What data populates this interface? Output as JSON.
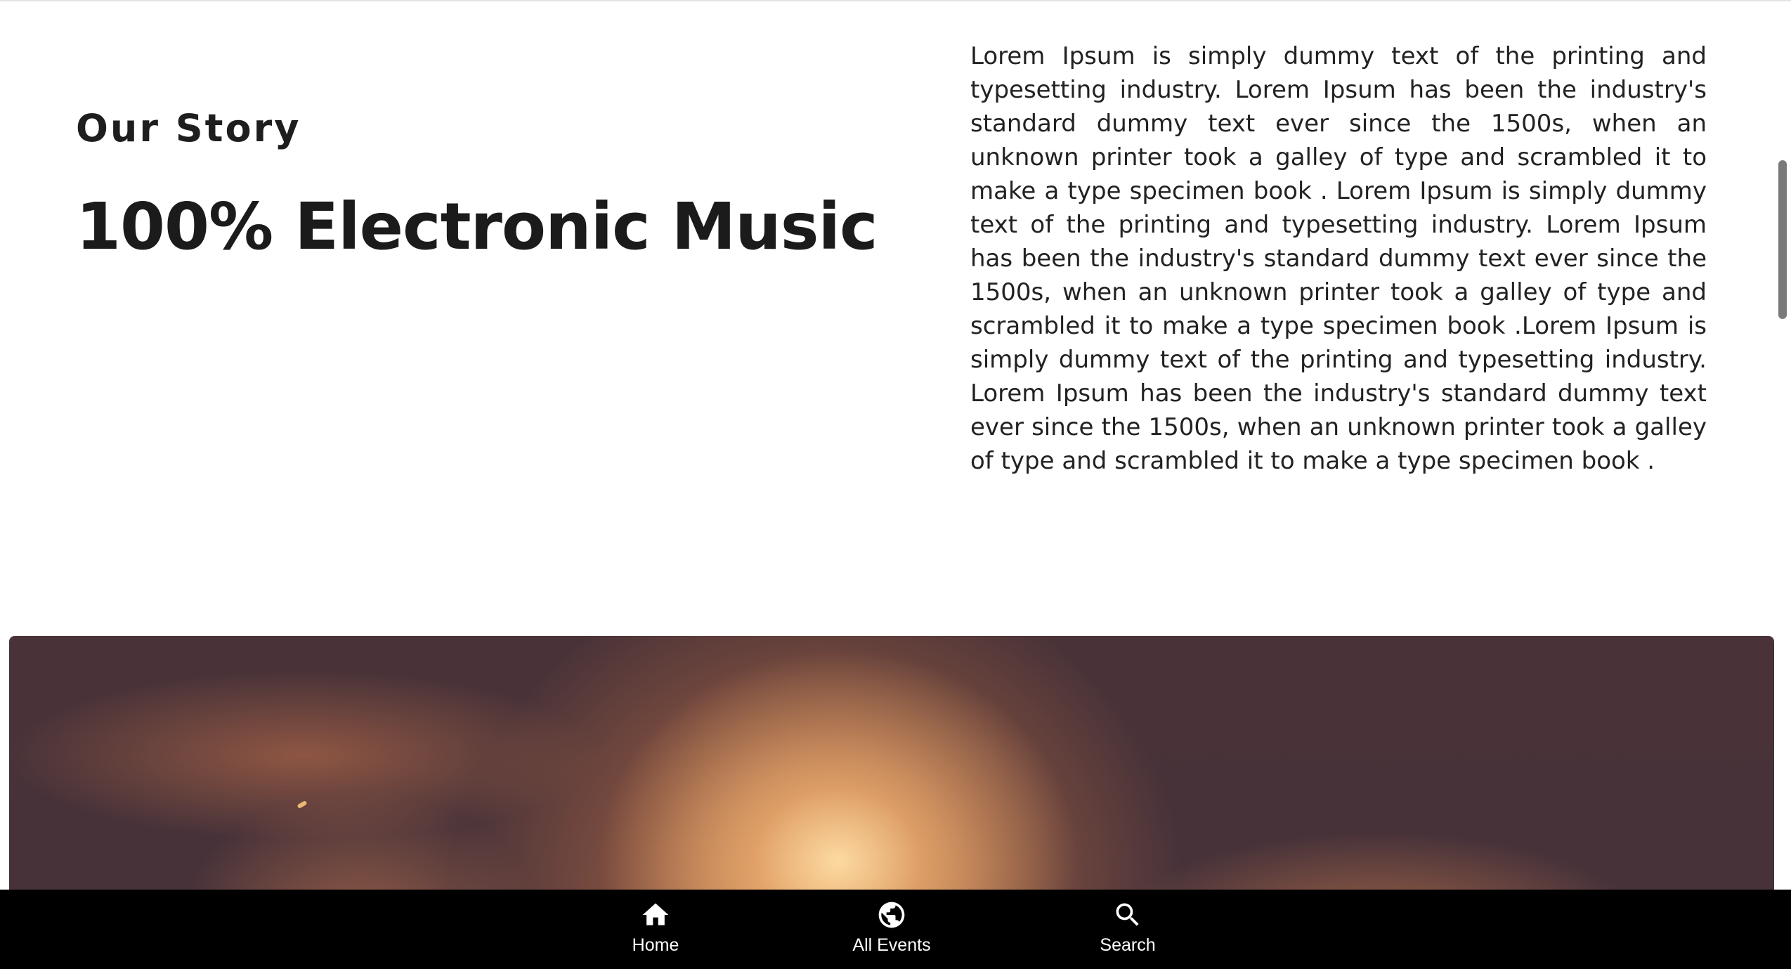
{
  "story": {
    "eyebrow": "Our Story",
    "headline": "100% Electronic Music",
    "body": "Lorem Ipsum is simply dummy text of the printing and typesetting industry. Lorem Ipsum has been the industry's standard dummy text ever since the 1500s, when an unknown printer took a galley of type and scrambled it to make a type specimen book . Lorem Ipsum is simply dummy text of the printing and typesetting industry. Lorem Ipsum has been the industry's standard dummy text ever since the 1500s, when an unknown printer took a galley of type and scrambled it to make a type specimen book .Lorem Ipsum is simply dummy text of the printing and typesetting industry. Lorem Ipsum has been the industry's standard dummy text ever since the 1500s, when an unknown printer took a galley of type and scrambled it to make a type specimen book ."
  },
  "bottom_nav": {
    "items": [
      {
        "label": "Home",
        "icon": "home-icon"
      },
      {
        "label": "All Events",
        "icon": "globe-icon"
      },
      {
        "label": "Search",
        "icon": "search-icon"
      }
    ]
  },
  "colors": {
    "text": "#1c1c1c",
    "nav_background": "#000000",
    "nav_text": "#ffffff",
    "hero_dark": "#4a3338",
    "hero_glow": "#f0b070"
  }
}
